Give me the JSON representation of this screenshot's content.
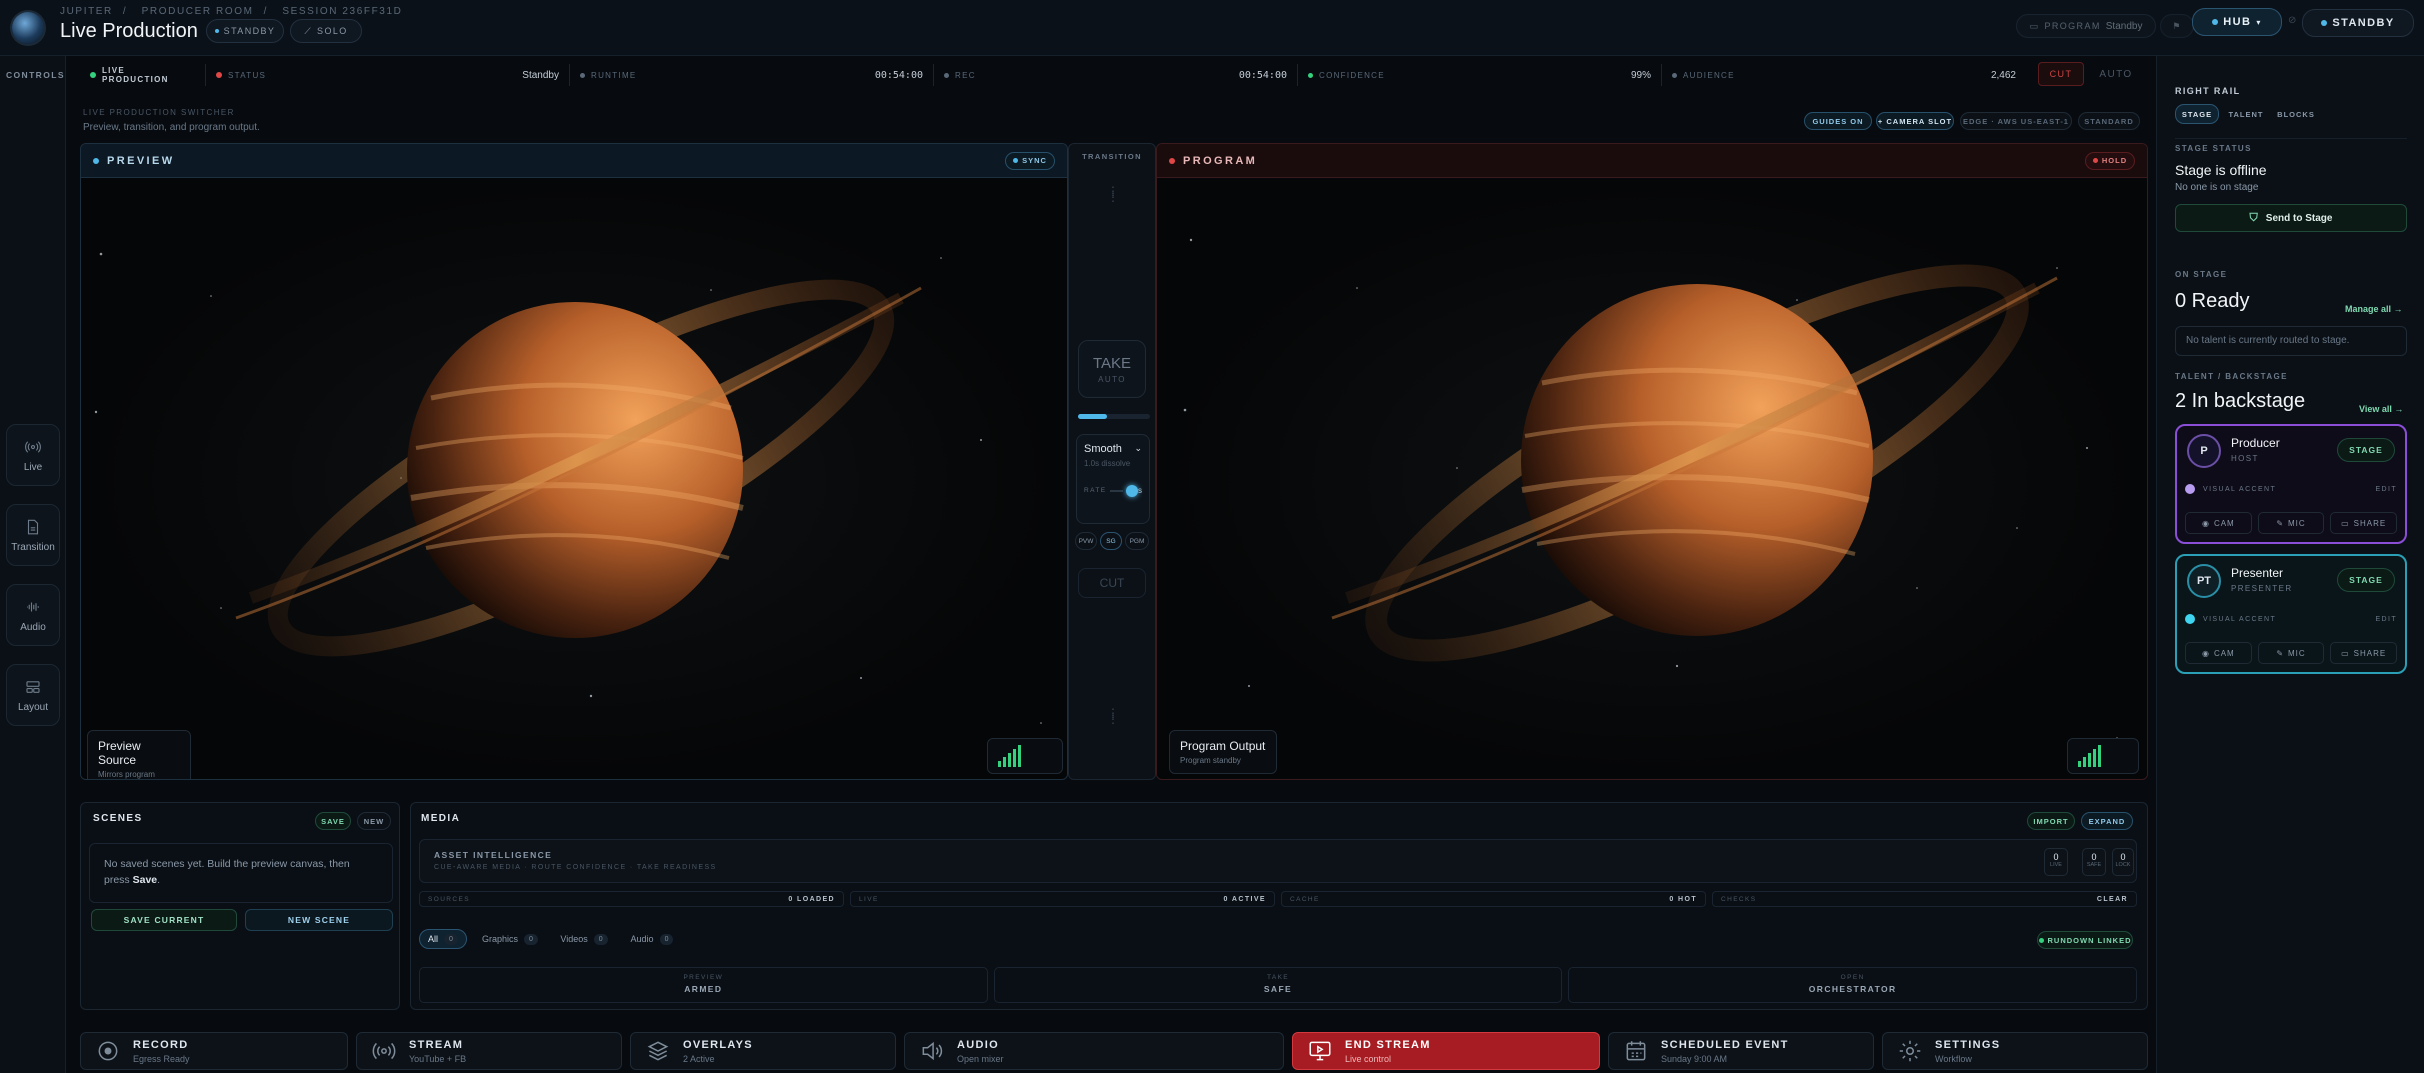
{
  "header": {
    "breadcrumb": [
      "JUPITER",
      "PRODUCER ROOM",
      "SESSION 236FF31D"
    ],
    "title": "Live Production",
    "standby_pill": "STANDBY",
    "solo_pill": "SOLO",
    "program_label": "PROGRAM",
    "program_value": "Standby",
    "hub_label": "HUB",
    "standby_right": "STANDBY"
  },
  "left_rail": {
    "label": "CONTROLS",
    "items": [
      {
        "label": "Live",
        "icon": "broadcast-icon"
      },
      {
        "label": "Transition",
        "icon": "document-icon"
      },
      {
        "label": "Audio",
        "icon": "waveform-icon"
      },
      {
        "label": "Layout",
        "icon": "layout-icon"
      }
    ]
  },
  "status": {
    "live_production": "LIVE PRODUCTION",
    "status_label": "STATUS",
    "status_value": "Standby",
    "runtime_label": "RUNTIME",
    "runtime_value": "00:54:00",
    "rec_label": "REC",
    "rec_value": "00:54:00",
    "confidence_label": "CONFIDENCE",
    "confidence_value": "99%",
    "audience_label": "AUDIENCE",
    "audience_value": "2,462",
    "cut": "CUT",
    "auto": "AUTO"
  },
  "switcher": {
    "title": "LIVE PRODUCTION SWITCHER",
    "subtitle": "Preview, transition, and program output.",
    "chips": [
      "GUIDES ON",
      "+ CAMERA SLOT",
      "EDGE · AWS US-EAST-1",
      "STANDARD"
    ]
  },
  "preview": {
    "title": "PREVIEW",
    "badge": "SYNC",
    "label": "Preview Source",
    "sublabel": "Mirrors program"
  },
  "program": {
    "title": "PROGRAM",
    "badge": "HOLD",
    "label": "Program Output",
    "sublabel": "Program standby"
  },
  "transition": {
    "title": "TRANSITION",
    "take": "TAKE",
    "auto": "AUTO",
    "progress": 0.4,
    "mode": "Smooth",
    "mode_sub": "1.0s dissolve",
    "rate_label": "RATE",
    "rate_value": "1.0s",
    "route": [
      "PVW",
      "SG",
      "PGM"
    ],
    "cut": "CUT"
  },
  "scenes": {
    "title": "SCENES",
    "save": "SAVE",
    "new": "NEW",
    "empty_text": "No saved scenes yet. Build the preview canvas, then press",
    "empty_bold": "Save",
    "period": ".",
    "save_current": "SAVE CURRENT",
    "new_scene": "NEW SCENE"
  },
  "media": {
    "title": "MEDIA",
    "import": "IMPORT",
    "expand": "EXPAND",
    "ai_title": "ASSET INTELLIGENCE",
    "ai_sub": "CUE-AWARE MEDIA · ROUTE CONFIDENCE · TAKE READINESS",
    "counters": [
      {
        "v": "0",
        "l": "LIVE"
      },
      {
        "v": "0",
        "l": "SAFE"
      },
      {
        "v": "0",
        "l": "LOCK"
      }
    ],
    "stats": [
      {
        "l": "SOURCES",
        "v": "0 LOADED"
      },
      {
        "l": "LIVE",
        "v": "0 ACTIVE"
      },
      {
        "l": "CACHE",
        "v": "0 HOT"
      },
      {
        "l": "CHECKS",
        "v": "CLEAR"
      }
    ],
    "tabs": [
      {
        "l": "All",
        "c": "0"
      },
      {
        "l": "Graphics",
        "c": "0"
      },
      {
        "l": "Videos",
        "c": "0"
      },
      {
        "l": "Audio",
        "c": "0"
      }
    ],
    "rundown": "RUNDOWN LINKED",
    "footer": [
      {
        "l": "PREVIEW",
        "v": "ARMED"
      },
      {
        "l": "TAKE",
        "v": "SAFE"
      },
      {
        "l": "OPEN",
        "v": "ORCHESTRATOR"
      }
    ]
  },
  "bottom": [
    {
      "t": "RECORD",
      "s": "Egress Ready",
      "icon": "record-icon"
    },
    {
      "t": "STREAM",
      "s": "YouTube + FB",
      "icon": "signal-icon"
    },
    {
      "t": "OVERLAYS",
      "s": "2 Active",
      "icon": "layers-icon"
    },
    {
      "t": "AUDIO",
      "s": "Open mixer",
      "icon": "speaker-icon"
    },
    {
      "t": "END STREAM",
      "s": "Live control",
      "icon": "monitor-icon"
    },
    {
      "t": "SCHEDULED EVENT",
      "s": "Sunday 9:00 AM",
      "icon": "calendar-icon"
    },
    {
      "t": "SETTINGS",
      "s": "Workflow",
      "icon": "gear-icon"
    }
  ],
  "right": {
    "title": "RIGHT RAIL",
    "tabs": [
      "STAGE",
      "TALENT",
      "BLOCKS"
    ],
    "stage_status_label": "STAGE STATUS",
    "stage_status": "Stage is offline",
    "stage_sub": "No one is on stage",
    "send": "Send to Stage",
    "on_stage_label": "ON STAGE",
    "ready": "0 Ready",
    "manage": "Manage all →",
    "no_talent": "No talent is currently routed to stage.",
    "backstage_label": "TALENT / BACKSTAGE",
    "backstage": "2 In backstage",
    "view_all": "View all →",
    "talent": [
      {
        "initials": "P",
        "name": "Producer",
        "role": "HOST",
        "accent": "#b79cf0",
        "border": "#8a4fd6"
      },
      {
        "initials": "PT",
        "name": "Presenter",
        "role": "PRESENTER",
        "accent": "#3fd5f0",
        "border": "#2a9fb6"
      }
    ],
    "stage_btn": "STAGE",
    "visual_accent": "VISUAL ACCENT",
    "edit": "EDIT",
    "cam": "CAM",
    "mic": "MIC",
    "share": "SHARE"
  },
  "colors": {
    "accent": "#4fb8e8",
    "live": "#34d17e",
    "alert": "#e04848",
    "end_stream": "#b51f24"
  }
}
